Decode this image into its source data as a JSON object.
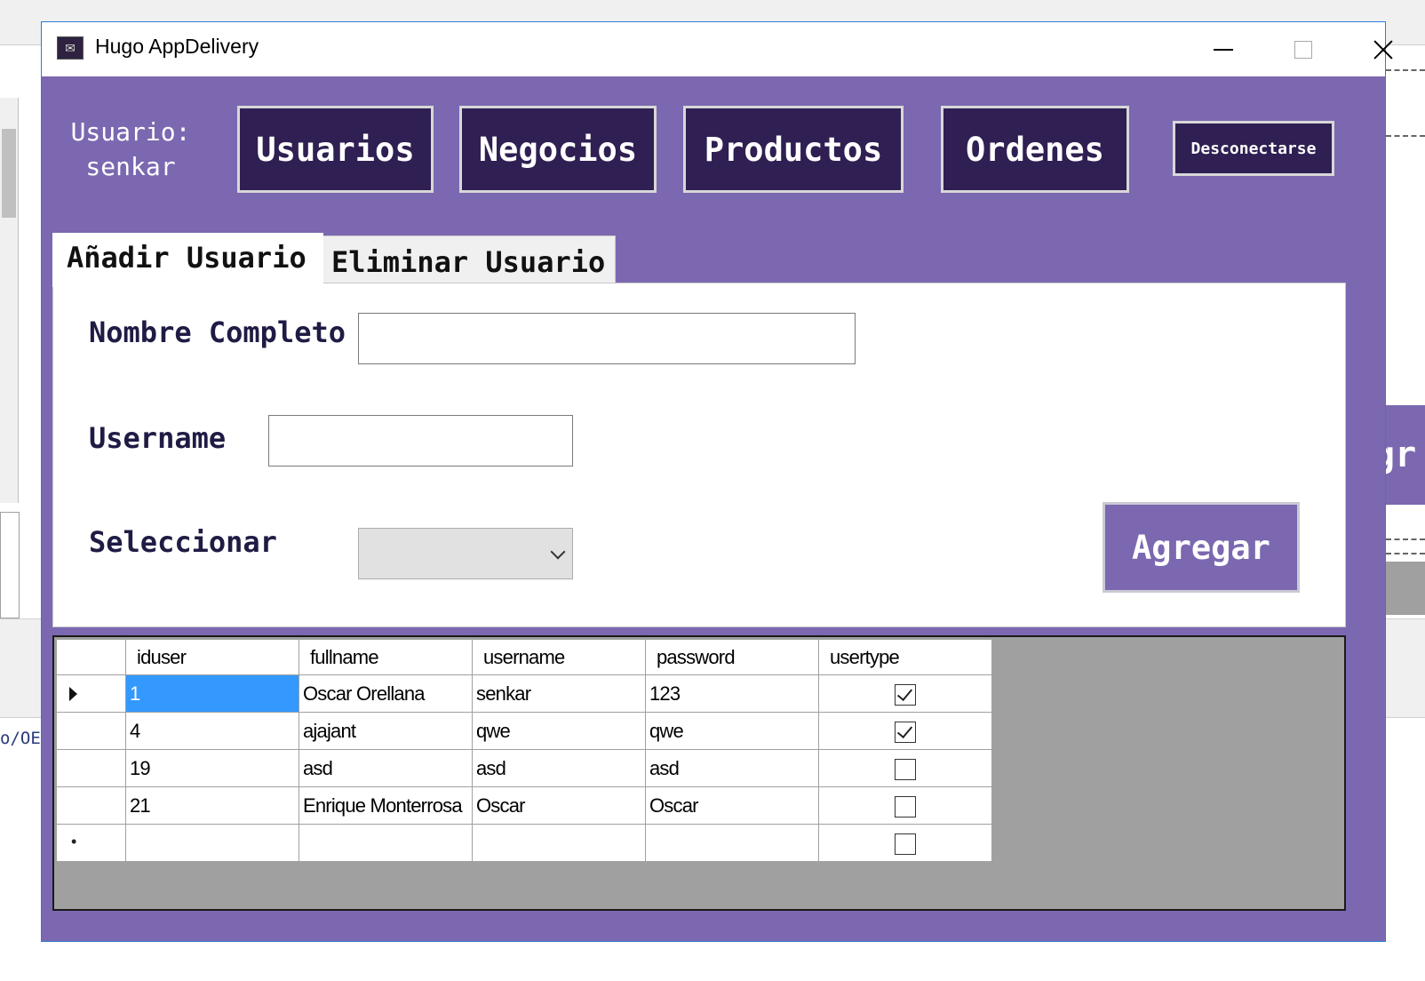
{
  "background": {
    "left_text": "o/OE",
    "right_button_fragment": "gr"
  },
  "window": {
    "title": "Hugo AppDelivery",
    "user_label_line1": "Usuario:",
    "user_label_line2": "senkar"
  },
  "nav": {
    "usuarios": "Usuarios",
    "negocios": "Negocios",
    "productos": "Productos",
    "ordenes": "Ordenes",
    "logout": "Desconectarse"
  },
  "tabs": [
    {
      "label": "Añadir Usuario",
      "active": true
    },
    {
      "label": "Eliminar Usuario",
      "active": false
    }
  ],
  "form": {
    "nombre_label": "Nombre Completo",
    "nombre_value": "",
    "username_label": "Username",
    "username_value": "",
    "select_label": "Seleccionar",
    "select_value": "",
    "submit_label": "Agregar"
  },
  "grid": {
    "columns": [
      "iduser",
      "fullname",
      "username",
      "password",
      "usertype"
    ],
    "rows": [
      {
        "iduser": "1",
        "fullname": "Oscar Orellana",
        "username": "senkar",
        "password": "123",
        "usertype": true
      },
      {
        "iduser": "4",
        "fullname": "ajajant",
        "username": "qwe",
        "password": "qwe",
        "usertype": true
      },
      {
        "iduser": "19",
        "fullname": "asd",
        "username": "asd",
        "password": "asd",
        "usertype": false
      },
      {
        "iduser": "21",
        "fullname": "Enrique Monterrosa",
        "username": "Oscar",
        "password": "Oscar",
        "usertype": false
      }
    ],
    "new_row_usertype": false
  },
  "colors": {
    "window_purple": "#7b68b0",
    "nav_button_dark": "#2f1f52",
    "selection_blue": "#3399ff",
    "label_navy": "#1e1c44"
  },
  "icons": {
    "app": "app-icon",
    "minimize": "minimize-icon",
    "maximize": "maximize-icon",
    "close": "close-icon",
    "dropdown": "chevron-down-icon",
    "current_row": "row-pointer-icon",
    "new_row": "new-row-icon"
  }
}
